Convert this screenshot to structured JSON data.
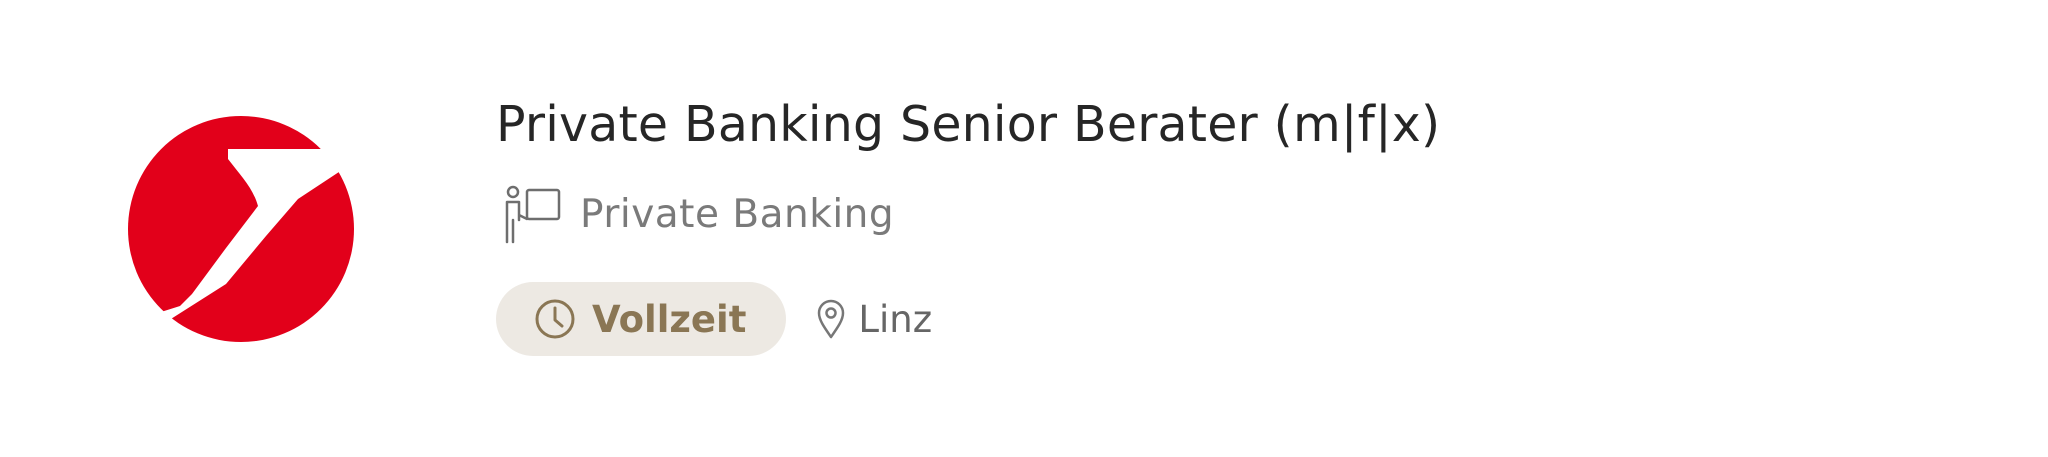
{
  "job": {
    "title": "Private Banking Senior Berater (m|f|x)",
    "department": "Private Banking",
    "employment_type": "Vollzeit",
    "location": "Linz"
  },
  "icons": {
    "logo": "unicredit-logo",
    "department": "presenter-board-icon",
    "employment_type": "clock-icon",
    "location": "map-pin-icon"
  },
  "colors": {
    "brand_red": "#e2001a",
    "title_text": "#262626",
    "muted_text": "#7a7a7a",
    "badge_background": "#ede9e3",
    "badge_text": "#8a7654",
    "location_text": "#666666"
  }
}
